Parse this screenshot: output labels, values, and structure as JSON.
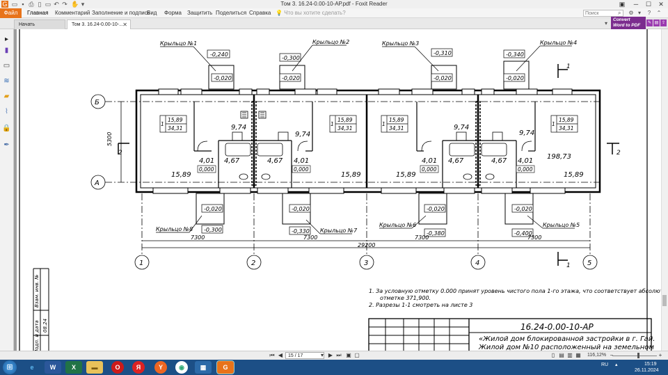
{
  "window": {
    "title": "Том 3. 16.24-0.00-10-АР.pdf - Foxit Reader"
  },
  "menu": {
    "items": [
      "Файл",
      "Главная",
      "Комментарий",
      "Заполнение и подпись",
      "Вид",
      "Форма",
      "Защитить",
      "Поделиться",
      "Справка"
    ],
    "tell_me": "Что вы хотите сделать?",
    "search_placeholder": "Поиск"
  },
  "tabs": {
    "start": "Начать",
    "document": "Том 3. 16.24-0.00-10-..."
  },
  "convert": {
    "line1": "Convert",
    "line2": "Word to PDF"
  },
  "drawing": {
    "porches_top": [
      {
        "label": "Крыльцо №1",
        "level_outer": "-0,240",
        "level_inner": "-0,020"
      },
      {
        "label": "Крыльцо №2",
        "level_outer": "-0,300",
        "level_inner": "-0,020"
      },
      {
        "label": "Крыльцо №3",
        "level_outer": "-0,310",
        "level_inner": "-0,020"
      },
      {
        "label": "Крыльцо №4",
        "level_outer": "-0,340",
        "level_inner": "-0,020"
      }
    ],
    "porches_bottom": [
      {
        "label": "Крыльцо №8",
        "level_inner": "-0,020",
        "level_outer": "-0,300"
      },
      {
        "label": "Крыльцо №7",
        "level_inner": "-0,020",
        "level_outer": "-0,330"
      },
      {
        "label": "Крыльцо №6",
        "level_inner": "-0,020",
        "level_outer": "-0,380"
      },
      {
        "label": "Крыльцо №5",
        "level_inner": "-0,020",
        "level_outer": "-0,400"
      }
    ],
    "axes_rows": [
      "Б",
      "А"
    ],
    "axes_cols": [
      "1",
      "2",
      "3",
      "4",
      "5"
    ],
    "dim_height": "5300",
    "dims_bays": [
      "7300",
      "7300",
      "7300",
      "7300"
    ],
    "dim_total": "29200",
    "section_mark": "1",
    "section_mark_side": "2",
    "room_tags": [
      {
        "num": "1",
        "a": "15,89",
        "b": "34,31"
      },
      {
        "num": "1",
        "a": "15,89",
        "b": "34,31"
      },
      {
        "num": "1",
        "a": "15,89",
        "b": "34,31"
      },
      {
        "num": "1",
        "a": "15,89",
        "b": "34,31"
      }
    ],
    "areas": [
      "9,74",
      "9,74",
      "9,74",
      "9,74",
      "4,01",
      "4,01",
      "4,01",
      "4,01",
      "4,67",
      "4,67",
      "4,67",
      "4,67",
      "15,89",
      "15,89",
      "15,89",
      "15,89",
      "198,73"
    ],
    "zero_level": "0,000",
    "notes": [
      "1. За условную отметку 0.000 принят уровень чистого пола 1-го этажа, что соответствует абсолютной",
      "отметке 371,900.",
      "2. Разрезы 1-1 смотреть на листе 3"
    ],
    "stamp": {
      "code": "16.24-0.00-10-АР",
      "line1": "«Жилой дом блокированной застройки в г. Гай.",
      "line2": "Жилой дом №10 расположенный на земельном"
    },
    "side_stamp": {
      "inv": "Взам. инв. №",
      "date": "Подп. и дата",
      "date_val": "08.24",
      "sign": "Подп."
    }
  },
  "nav": {
    "page": "15 / 17",
    "zoom": "116,12%"
  },
  "taskbar": {
    "lang": "RU",
    "time": "15:19",
    "date": "26.11.2024"
  }
}
